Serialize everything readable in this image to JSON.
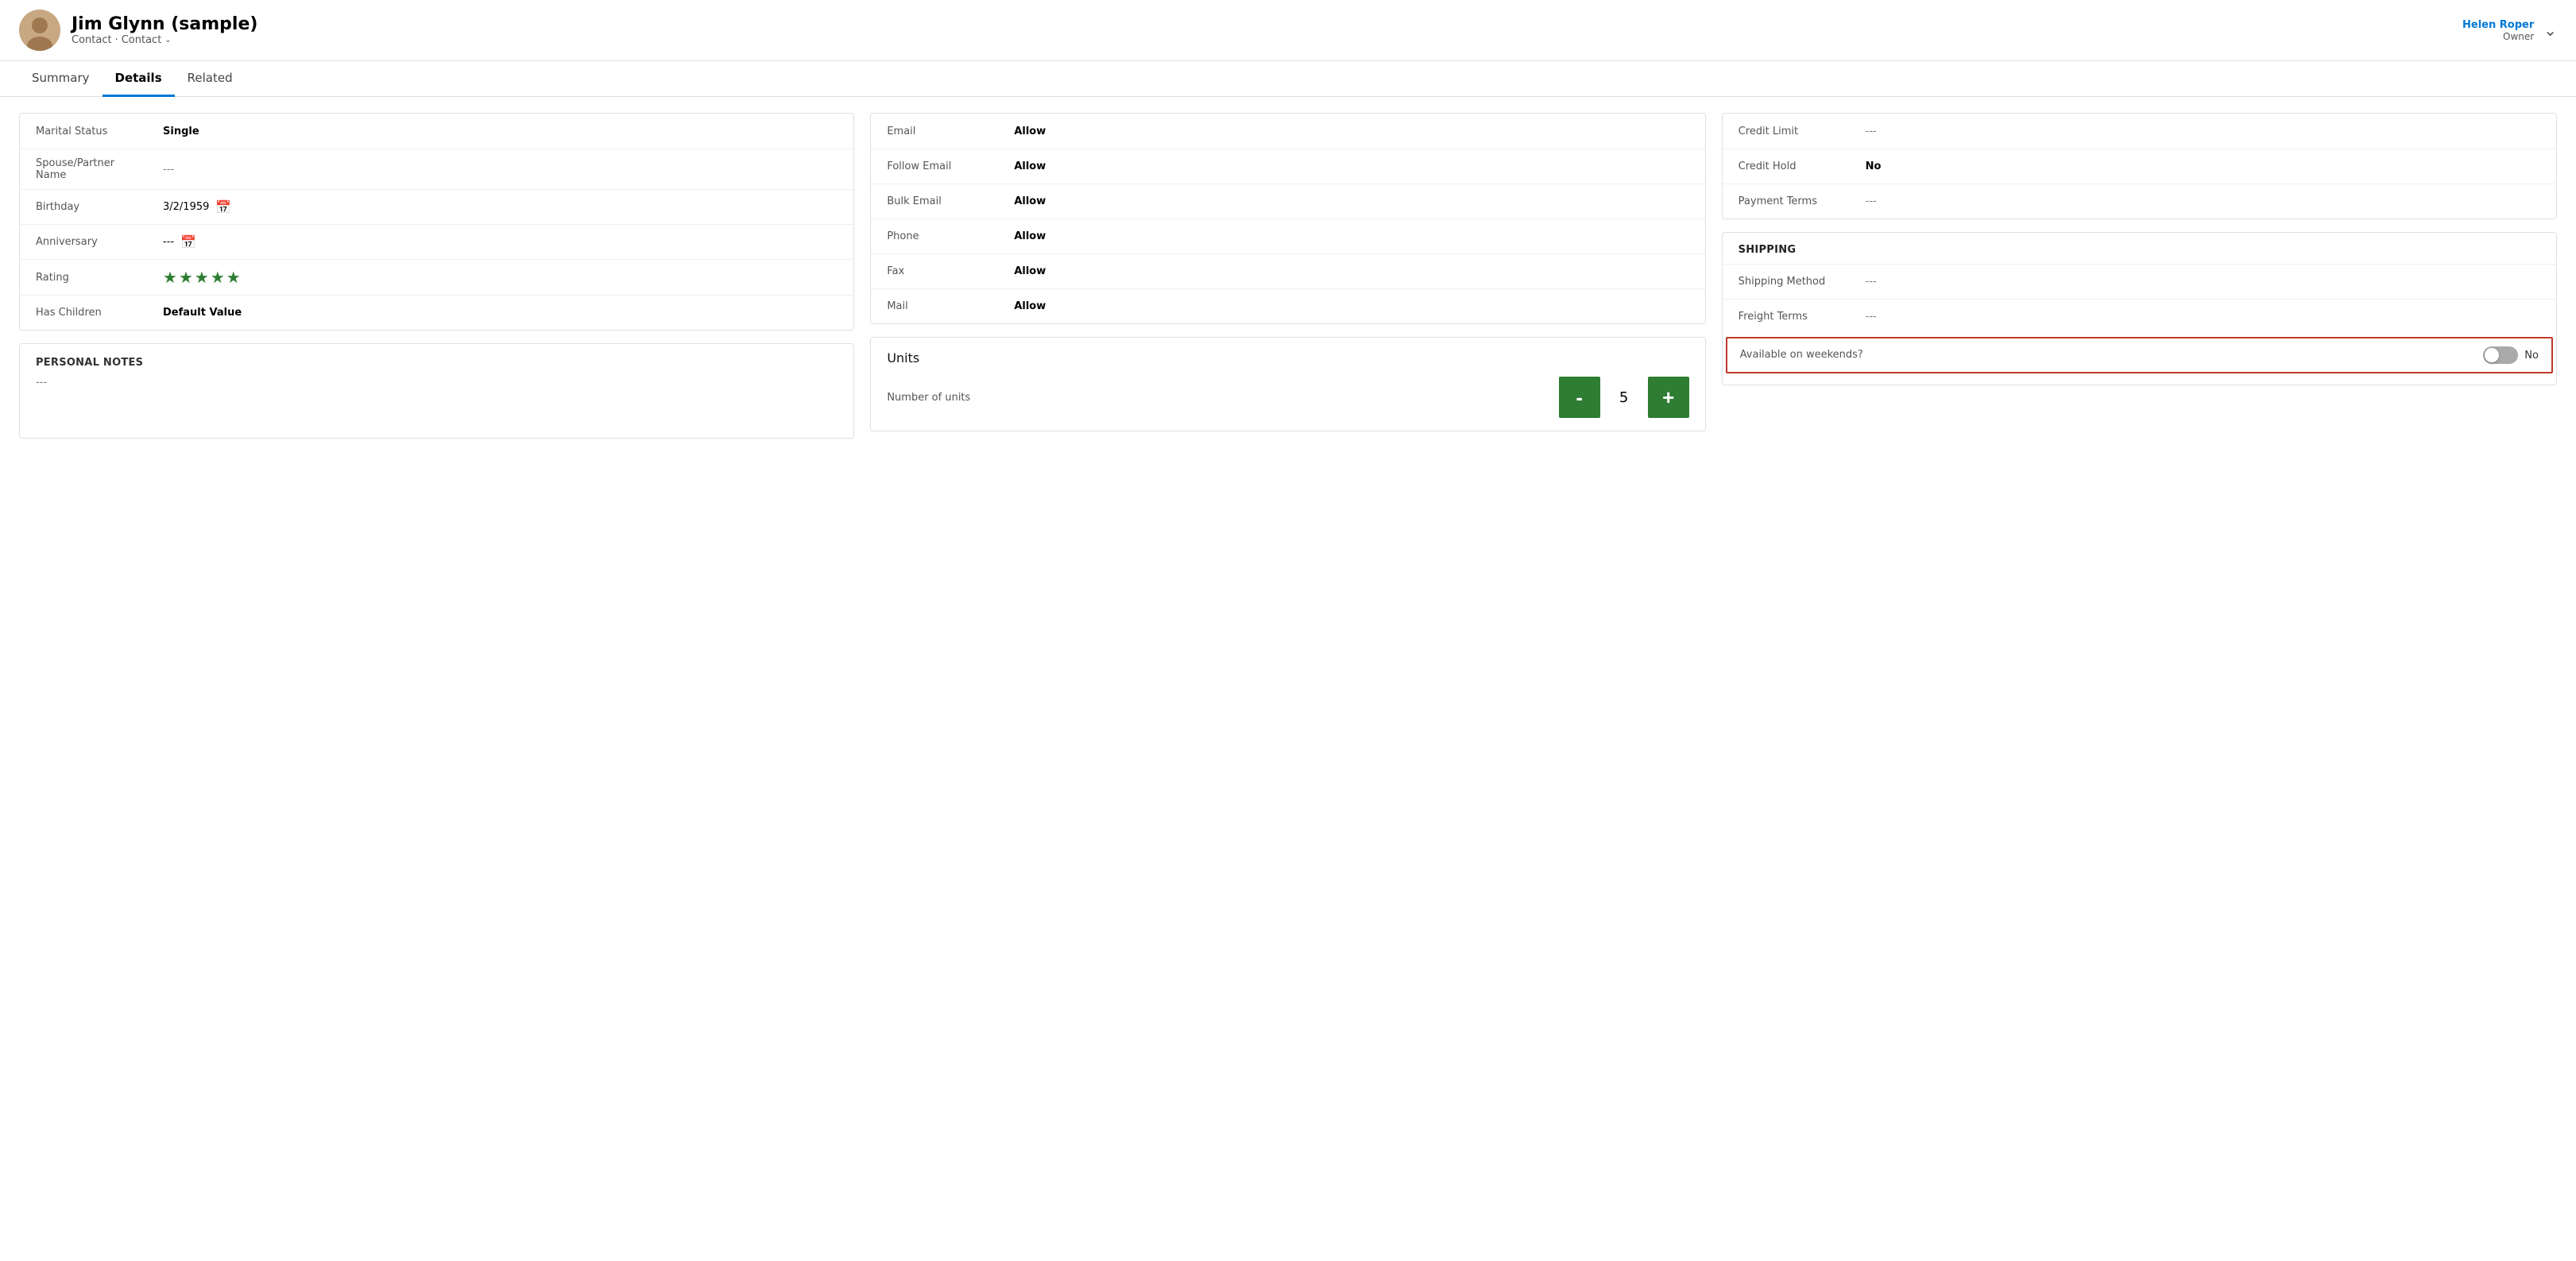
{
  "header": {
    "name": "Jim Glynn (sample)",
    "subtitle1": "Contact",
    "subtitle2": "Contact",
    "owner_label": "Owner",
    "owner_name": "Helen Roper",
    "avatar_emoji": "👤"
  },
  "tabs": [
    {
      "label": "Summary",
      "active": false
    },
    {
      "label": "Details",
      "active": true
    },
    {
      "label": "Related",
      "active": false
    }
  ],
  "personal_info": {
    "title": "",
    "fields": [
      {
        "label": "Marital Status",
        "value": "Single",
        "bold": true
      },
      {
        "label": "Spouse/Partner Name",
        "value": "---",
        "bold": false,
        "muted": true
      },
      {
        "label": "Birthday",
        "value": "3/2/1959",
        "hasCalendar": true
      },
      {
        "label": "Anniversary",
        "value": "---",
        "hasCalendar": true,
        "muted": true
      },
      {
        "label": "Rating",
        "value": "stars"
      },
      {
        "label": "Has Children",
        "value": "Default Value",
        "bold": true
      }
    ]
  },
  "personal_notes": {
    "title": "PERSONAL NOTES",
    "value": "---"
  },
  "communication": {
    "fields": [
      {
        "label": "Email",
        "value": "Allow",
        "bold": true
      },
      {
        "label": "Follow Email",
        "value": "Allow",
        "bold": true
      },
      {
        "label": "Bulk Email",
        "value": "Allow",
        "bold": true
      },
      {
        "label": "Phone",
        "value": "Allow",
        "bold": true
      },
      {
        "label": "Fax",
        "value": "Allow",
        "bold": true
      },
      {
        "label": "Mail",
        "value": "Allow",
        "bold": true
      }
    ]
  },
  "units": {
    "title": "Units",
    "label": "Number of units",
    "value": "5",
    "btn_minus": "-",
    "btn_plus": "+"
  },
  "billing": {
    "fields": [
      {
        "label": "Credit Limit",
        "value": "---",
        "muted": true
      },
      {
        "label": "Credit Hold",
        "value": "No",
        "bold": true
      },
      {
        "label": "Payment Terms",
        "value": "---",
        "muted": true
      }
    ]
  },
  "shipping": {
    "title": "SHIPPING",
    "fields": [
      {
        "label": "Shipping Method",
        "value": "---",
        "muted": true
      },
      {
        "label": "Freight Terms",
        "value": "---",
        "muted": true
      }
    ],
    "available_label": "Available on weekends?",
    "available_value": "No",
    "toggle_state": false
  },
  "stars_count": 5,
  "colors": {
    "accent": "#0078d4",
    "star": "#2e7d32",
    "btn_green": "#2e7d32",
    "highlight_red": "#c0392b"
  }
}
